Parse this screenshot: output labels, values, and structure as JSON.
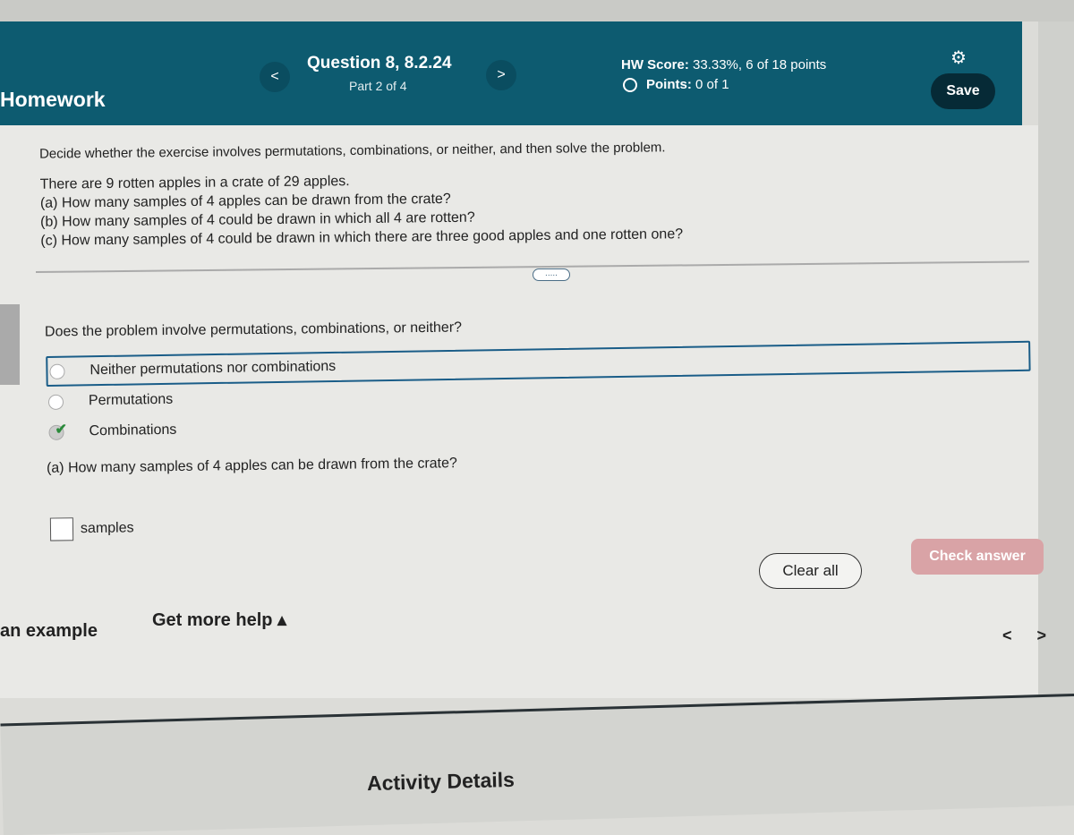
{
  "header": {
    "title": "Homework",
    "question": "Question 8, 8.2.24",
    "part": "Part 2 of 4",
    "prev_icon": "chevron-left-icon",
    "next_icon": "chevron-right-icon",
    "prev_label": "<",
    "next_label": ">",
    "hw_score_label": "HW Score:",
    "hw_score_value": "33.33%, 6 of 18 points",
    "points_label": "Points:",
    "points_value": "0 of 1",
    "settings_icon": "gear-icon",
    "save_label": "Save",
    "color": "#0d5b70"
  },
  "problem": {
    "instruction": "Decide whether the exercise involves permutations, combinations, or neither, and then solve the problem.",
    "lines": [
      "There are 9 rotten apples in a crate of 29 apples.",
      "(a) How many samples of 4 apples can be drawn from the crate?",
      "(b) How many samples of 4 could be drawn in which all 4 are rotten?",
      "(c) How many samples of 4 could be drawn in which there are three good apples and one rotten one?"
    ],
    "more_label": "....."
  },
  "question": {
    "prompt": "Does the problem involve permutations, combinations, or neither?",
    "options": [
      "Neither permutations nor combinations",
      "Permutations",
      "Combinations"
    ],
    "selected": "Combinations",
    "part_a": "(a) How many samples of 4 apples can be drawn from the crate?",
    "answer_value": "",
    "answer_unit": "samples"
  },
  "actions": {
    "clear_all": "Clear all",
    "check_answer": "Check answer",
    "view_example": "an example",
    "get_more_help": "Get more help ▴",
    "prev": "<",
    "next": ">"
  },
  "footer": {
    "activity_details": "Activity Details"
  }
}
